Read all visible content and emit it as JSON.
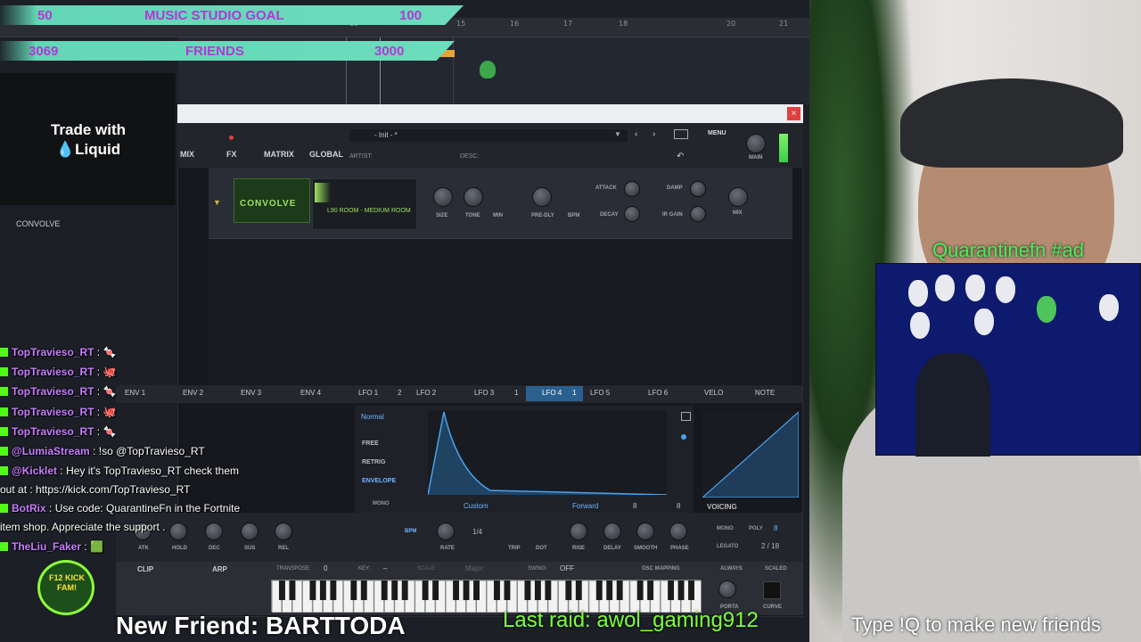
{
  "goals": {
    "music": {
      "current": "50",
      "label": "MUSIC STUDIO GOAL",
      "target": "100"
    },
    "friends": {
      "current": "3069",
      "label": "FRIENDS",
      "target": "3000"
    }
  },
  "timeline": {
    "ticks": [
      "13",
      "15",
      "16",
      "17",
      "18",
      "20",
      "21"
    ]
  },
  "ad": {
    "line1": "Trade with",
    "line2": "💧Liquid"
  },
  "browser": {
    "item": "CONVOLVE"
  },
  "synth": {
    "close": "×",
    "preset_name": "- Init - *",
    "artist_label": "ARTIST:",
    "desc_label": "DESC:",
    "menu": "MENU",
    "main": "MAIN",
    "tabs": [
      "MIX",
      "FX",
      "MATRIX",
      "GLOBAL"
    ],
    "fx": {
      "module_name": "CONVOLVE",
      "ir_name": "L90 ROOM - MEDIUM ROOM",
      "knobs": [
        "SIZE",
        "TONE",
        "MIN",
        "PRE-DLY",
        "BPM",
        "ATTACK",
        "DECAY",
        "DAMP",
        "IR GAIN",
        "MIX"
      ]
    },
    "mod_tabs": [
      "ENV 1",
      "ENV 2",
      "ENV 3",
      "ENV 4",
      "LFO 1",
      "LFO 2",
      "LFO 3",
      "LFO 4",
      "LFO 5",
      "LFO 6",
      "VELO",
      "NOTE"
    ],
    "mod_badges": {
      "lfo1": "2",
      "lfo3": "1",
      "lfo4": "1"
    },
    "lfo": {
      "mode": "Normal",
      "options": [
        "FREE",
        "RETRIG",
        "ENVELOPE"
      ],
      "shape": "Custom",
      "direction": "Forward",
      "grid1": "8",
      "grid2": "8",
      "mono": "MONO",
      "sync": "BPM",
      "rate_value": "1/4",
      "knobs": [
        "RATE",
        "TRIP",
        "DOT",
        "RISE",
        "DELAY",
        "SMOOTH",
        "PHASE"
      ]
    },
    "env_knobs": [
      "ATK",
      "HOLD",
      "DEC",
      "SUS",
      "REL"
    ],
    "voicing": {
      "title": "VOICING",
      "mono": "MONO",
      "poly": "POLY",
      "poly_val": "8",
      "legato": "LEGATO",
      "legato_val": "2 / 18"
    },
    "keys": {
      "clip": "CLIP",
      "arp": "ARP",
      "transpose": "TRANSPOSE:",
      "transpose_val": "0",
      "key": "KEY:",
      "key_val": "–",
      "scale": "SCALE:",
      "scale_val": "Major",
      "swing": "SWING:",
      "swing_val": "OFF",
      "osc_mapping": "OSC MAPPING",
      "always": "ALWAYS",
      "scaled": "SCALED",
      "porta": "PORTA",
      "curve": "CURVE"
    }
  },
  "chat": [
    {
      "user": "TopTravieso_RT",
      "sep": " : ",
      "msg": "🍬"
    },
    {
      "user": "TopTravieso_RT",
      "sep": " : ",
      "msg": "🐙"
    },
    {
      "user": "TopTravieso_RT",
      "sep": " : ",
      "msg": "🍬"
    },
    {
      "user": "TopTravieso_RT",
      "sep": " : ",
      "msg": "🐙"
    },
    {
      "user": "TopTravieso_RT",
      "sep": " : ",
      "msg": "🍬"
    },
    {
      "user": "@LumiaStream",
      "sep": " : ",
      "msg": "!so @TopTravieso_RT"
    },
    {
      "user": "@Kicklet",
      "sep": " : ",
      "msg": "Hey it's TopTravieso_RT check them"
    },
    {
      "user": "",
      "sep": "",
      "msg": "out at : https://kick.com/TopTravieso_RT"
    },
    {
      "user": "BotRix",
      "sep": " : ",
      "msg": "Use code: QuarantineFn in the Fortnite"
    },
    {
      "user": "",
      "sep": "",
      "msg": "item shop. Appreciate the support ."
    },
    {
      "user": "TheLiu_Faker",
      "sep": " : ",
      "msg": "🟩"
    }
  ],
  "webcam": {
    "inset_title": "Quarantinefn  #ad"
  },
  "tickers": {
    "new_friend": "New Friend: BARTTODA",
    "last_raid": "Last raid: awol_gaming912",
    "type_q": "Type !Q to make new friends"
  },
  "logo": {
    "text": "F12 KICK FAM!"
  },
  "colors": {
    "goal_bar": "#63d7b6",
    "goal_text": "#b536d8",
    "chat_user": "#c77dff",
    "kick_green": "#53fc18",
    "raid_text": "#7cff3a",
    "accent_blue": "#2f8fe0"
  }
}
